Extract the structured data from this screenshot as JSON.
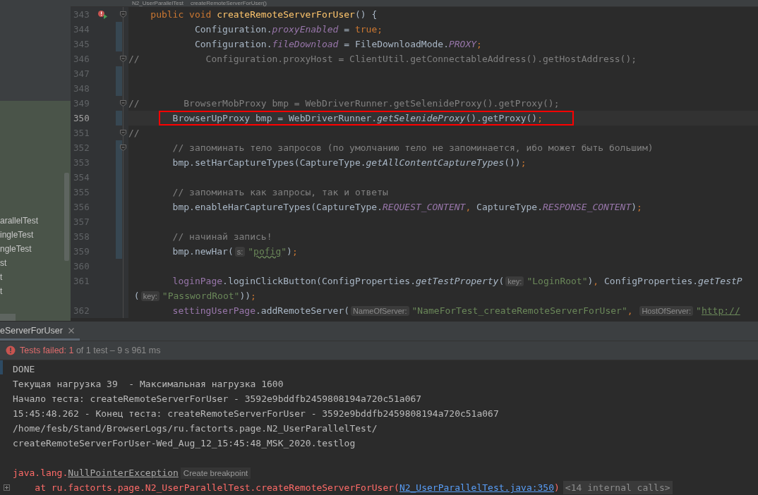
{
  "breadcrumb": [
    "N2_UserParallelTest",
    "createRemoteServerForUser()"
  ],
  "project_tree": {
    "items": [
      {
        "label": "arallelTest"
      },
      {
        "label": "ingleTest"
      },
      {
        "label": "ngleTest"
      },
      {
        "label": "st"
      },
      {
        "label": "t"
      },
      {
        "label": "t"
      }
    ]
  },
  "editor": {
    "lines": [
      {
        "number": "343",
        "run_failed": true,
        "fold": true,
        "tokens": [
          {
            "kind": "keyword",
            "text": "    public void "
          },
          {
            "kind": "decl",
            "text": "createRemoteServerForUser"
          },
          {
            "kind": "plain",
            "text": "() {"
          }
        ]
      },
      {
        "number": "344",
        "changed": true,
        "tokens": [
          {
            "kind": "plain",
            "text": "            Configuration."
          },
          {
            "kind": "field",
            "text": "proxyEnabled"
          },
          {
            "kind": "plain",
            "text": " = "
          },
          {
            "kind": "keyword",
            "text": "true"
          },
          {
            "kind": "punct",
            "text": ";"
          }
        ]
      },
      {
        "number": "345",
        "changed": true,
        "tokens": [
          {
            "kind": "plain",
            "text": "            Configuration."
          },
          {
            "kind": "field",
            "text": "fileDownload"
          },
          {
            "kind": "plain",
            "text": " = FileDownloadMode."
          },
          {
            "kind": "field",
            "text": "PROXY"
          },
          {
            "kind": "punct",
            "text": ";"
          }
        ]
      },
      {
        "number": "346",
        "fold": true,
        "tokens": [
          {
            "kind": "comment",
            "text": "//            Configuration.proxyHost = ClientUtil.getConnectableAddress().getHostAddress();"
          }
        ]
      },
      {
        "number": "347",
        "changed": true
      },
      {
        "number": "348",
        "changed": true
      },
      {
        "number": "349",
        "fold": true,
        "tokens": [
          {
            "kind": "comment",
            "text": "//        BrowserMobProxy bmp = WebDriverRunner.getSelenideProxy().getProxy();"
          }
        ]
      },
      {
        "number": "350",
        "changed": true,
        "current": true,
        "boxed": true,
        "tokens": [
          {
            "kind": "plain",
            "text": "        BrowserUpProxy bmp = WebDriverRunner."
          },
          {
            "kind": "static",
            "text": "getSelenideProxy"
          },
          {
            "kind": "plain",
            "text": "().getProxy()"
          },
          {
            "kind": "punct",
            "text": ";"
          }
        ]
      },
      {
        "number": "351",
        "fold": true,
        "tokens": [
          {
            "kind": "comment",
            "text": "//"
          }
        ]
      },
      {
        "number": "352",
        "fold": true,
        "changed": true,
        "tokens": [
          {
            "kind": "comment",
            "text": "        // запоминать тело запросов (по умолчанию тело не запоминается, ибо может быть большим)"
          }
        ]
      },
      {
        "number": "353",
        "changed": true,
        "tokens": [
          {
            "kind": "plain",
            "text": "        bmp.setHarCaptureTypes(CaptureType."
          },
          {
            "kind": "static",
            "text": "getAllContentCaptureTypes"
          },
          {
            "kind": "plain",
            "text": "())"
          },
          {
            "kind": "punct",
            "text": ";"
          }
        ]
      },
      {
        "number": "354",
        "changed": true
      },
      {
        "number": "355",
        "changed": true,
        "tokens": [
          {
            "kind": "comment",
            "text": "        // запоминать как запросы, так и ответы"
          }
        ]
      },
      {
        "number": "356",
        "changed": true,
        "tokens": [
          {
            "kind": "plain",
            "text": "        bmp.enableHarCaptureTypes(CaptureType."
          },
          {
            "kind": "field",
            "text": "REQUEST_CONTENT"
          },
          {
            "kind": "punct",
            "text": ", "
          },
          {
            "kind": "plain",
            "text": "CaptureType."
          },
          {
            "kind": "field",
            "text": "RESPONSE_CONTENT"
          },
          {
            "kind": "plain",
            "text": ")"
          },
          {
            "kind": "punct",
            "text": ";"
          }
        ]
      },
      {
        "number": "357",
        "changed": true
      },
      {
        "number": "358",
        "changed": true,
        "tokens": [
          {
            "kind": "comment",
            "text": "        // начинай запись!"
          }
        ]
      },
      {
        "number": "359",
        "changed": true,
        "tokens": [
          {
            "kind": "plain",
            "text": "        bmp.newHar("
          },
          {
            "kind": "hint",
            "text": "s:"
          },
          {
            "kind": "string",
            "text": "\""
          },
          {
            "kind": "typo",
            "text": "pofig"
          },
          {
            "kind": "string",
            "text": "\""
          },
          {
            "kind": "plain",
            "text": ")"
          },
          {
            "kind": "punct",
            "text": ";"
          }
        ]
      },
      {
        "number": "360"
      },
      {
        "number": "361",
        "tokens": [
          {
            "kind": "member",
            "text": "        loginPage"
          },
          {
            "kind": "plain",
            "text": ".loginClickButton(ConfigProperties."
          },
          {
            "kind": "static",
            "text": "getTestProperty"
          },
          {
            "kind": "plain",
            "text": "("
          },
          {
            "kind": "hint",
            "text": "key:"
          },
          {
            "kind": "string",
            "text": "\"LoginRoot\""
          },
          {
            "kind": "plain",
            "text": ")"
          },
          {
            "kind": "punct",
            "text": ", "
          },
          {
            "kind": "plain",
            "text": "ConfigProperties."
          },
          {
            "kind": "static",
            "text": "getTestP"
          }
        ]
      },
      {
        "tokens": [
          {
            "kind": "plain",
            "text": " ("
          },
          {
            "kind": "hint",
            "text": "key:"
          },
          {
            "kind": "string",
            "text": "\"PasswordRoot\""
          },
          {
            "kind": "plain",
            "text": "))"
          },
          {
            "kind": "punct",
            "text": ";"
          }
        ]
      },
      {
        "number": "362",
        "tokens": [
          {
            "kind": "member",
            "text": "        settingUserPage"
          },
          {
            "kind": "plain",
            "text": ".addRemoteServer("
          },
          {
            "kind": "hint",
            "text": "NameOfServer:"
          },
          {
            "kind": "string",
            "text": "\"NameForTest_createRemoteServerForUser\""
          },
          {
            "kind": "punct",
            "text": ", "
          },
          {
            "kind": "hint",
            "text": "HostOfServer:"
          },
          {
            "kind": "string",
            "text": "\""
          },
          {
            "kind": "url",
            "text": "http://"
          }
        ]
      }
    ]
  },
  "run_panel": {
    "tabs": [
      {
        "label": "eServerForUser",
        "selected": true
      }
    ],
    "status": {
      "failed": true,
      "summary": "Tests failed: 1",
      "detail": " of 1 test – 9 s 961 ms"
    },
    "console": [
      {
        "tokens": [
          {
            "kind": "text",
            "text": "DONE"
          }
        ]
      },
      {
        "tokens": [
          {
            "kind": "text",
            "text": "Текущая нагрузка 39  - Максимальная нагрузка 1600"
          }
        ]
      },
      {
        "tokens": [
          {
            "kind": "text",
            "text": "Начало теста: createRemoteServerForUser - 3592e9bddfb2459808194a720c51a067"
          }
        ]
      },
      {
        "tokens": [
          {
            "kind": "text",
            "text": "15:45:48.262 - Конец теста: createRemoteServerForUser - 3592e9bddfb2459808194a720c51a067"
          }
        ]
      },
      {
        "tokens": [
          {
            "kind": "text",
            "text": "/home/fesb/Stand/BrowserLogs/ru.factorts.page.N2_UserParallelTest/"
          }
        ]
      },
      {
        "tokens": [
          {
            "kind": "text",
            "text": "createRemoteServerForUser-Wed_Aug_12_15:45:48_MSK_2020.testlog"
          }
        ]
      },
      {
        "blank_before": true,
        "tokens": [
          {
            "kind": "error",
            "text": "java.lang."
          },
          {
            "kind": "exception",
            "text": "NullPointerException"
          },
          {
            "kind": "action",
            "text": "Create breakpoint"
          }
        ]
      },
      {
        "expandable": true,
        "tokens": [
          {
            "kind": "error",
            "text": "    at ru.factorts.page.N2_UserParallelTest.createRemoteServerForUser("
          },
          {
            "kind": "link",
            "text": "N2_UserParallelTest.java:350"
          },
          {
            "kind": "error",
            "text": ")"
          },
          {
            "kind": "folded",
            "text": "<14 internal calls>"
          }
        ]
      }
    ]
  }
}
